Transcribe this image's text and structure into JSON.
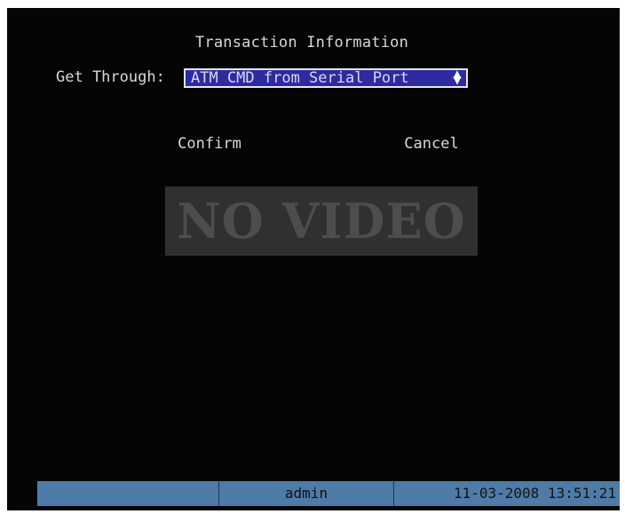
{
  "dialog": {
    "title": "Transaction Information",
    "get_through_label": "Get Through:",
    "get_through_value": "ATM CMD from Serial Port",
    "confirm_label": "Confirm",
    "cancel_label": "Cancel"
  },
  "video": {
    "status_text": "NO VIDEO"
  },
  "status_bar": {
    "user": "admin",
    "datetime": "11-03-2008 13:51:21"
  },
  "icons": {
    "select_arrow": "up-down-arrow-icon"
  },
  "colors": {
    "screen_bg": "#050505",
    "text": "#d8d8d0",
    "select_bg": "#2d2b9f",
    "select_border": "#e6e6ef",
    "status_bar_bg": "#4e7ba7",
    "no_video_bg": "#303030",
    "no_video_text": "#4d4d4d"
  }
}
